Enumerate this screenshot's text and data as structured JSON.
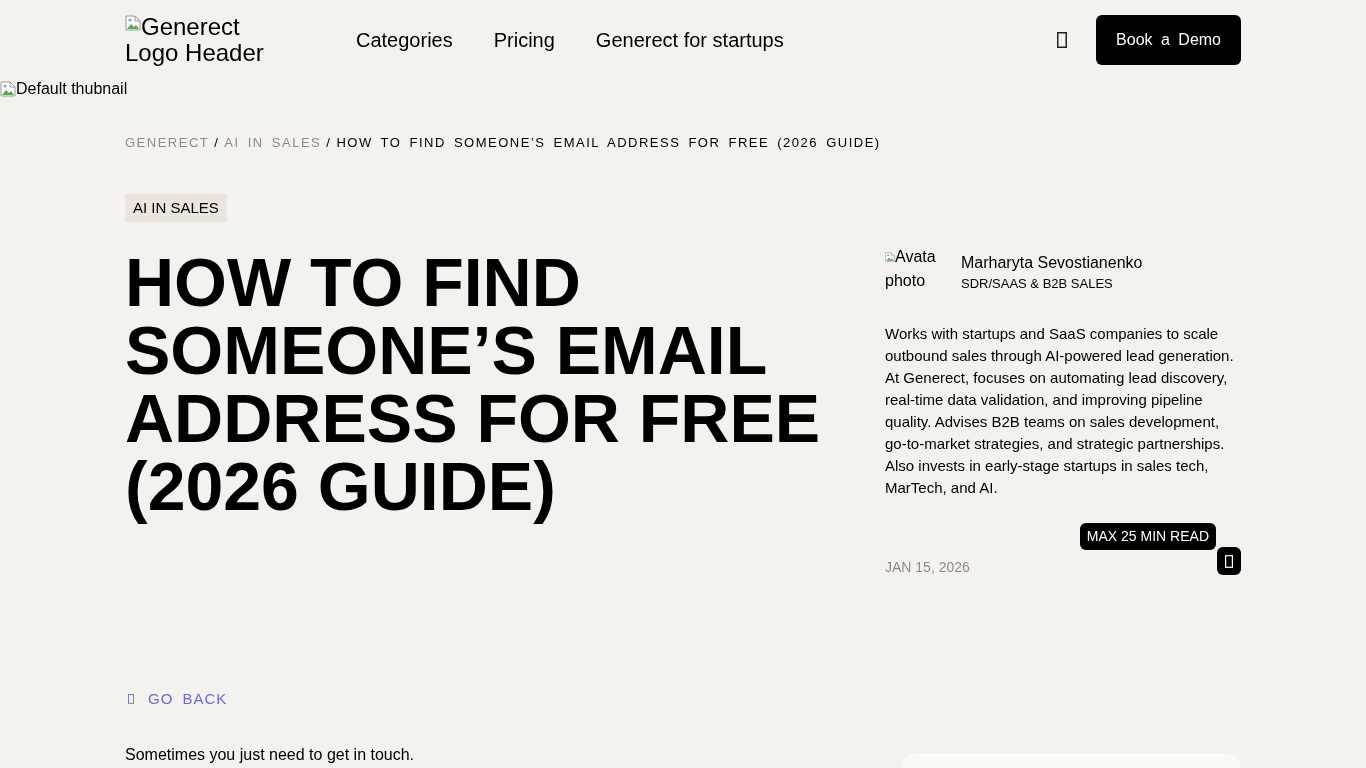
{
  "header": {
    "logo_alt": "Generect Logo Header",
    "nav": [
      {
        "label": "Categories"
      },
      {
        "label": "Pricing"
      },
      {
        "label": "Generect for startups"
      }
    ],
    "cta": "Book a Demo"
  },
  "thumbnail_alt": "Default thubnail",
  "breadcrumb": [
    {
      "label": "GENERECT",
      "current": false
    },
    {
      "separator": "/",
      "label": "AI IN SALES",
      "current": false
    },
    {
      "separator": "/",
      "label": "HOW TO FIND SOMEONE’S EMAIL ADDRESS FOR FREE (2026 GUIDE)",
      "current": true
    }
  ],
  "article": {
    "tag": "AI IN SALES",
    "title": "HOW TO FIND SOMEONE’S EMAIL ADDRESS FOR FREE (2026 GUIDE)",
    "author": {
      "avatar_alt": "Avata photo",
      "name": "Marharyta Sevostianenko",
      "role": "SDR/SAAS & B2B SALES",
      "bio": "Works with startups and SaaS companies to scale outbound sales through AI-powered lead generation. At Generect, focuses on automating lead discovery, real-time data validation, and improving pipeline quality. Advises B2B teams on sales development, go-to-market strategies, and strategic partnerships. Also invests in early-stage startups in sales tech, MarTech, and AI."
    },
    "read_time": "MAX 25 MIN READ",
    "date": "JAN 15, 2026"
  },
  "go_back": "GO BACK",
  "intro": "Sometimes you just need to get in touch."
}
